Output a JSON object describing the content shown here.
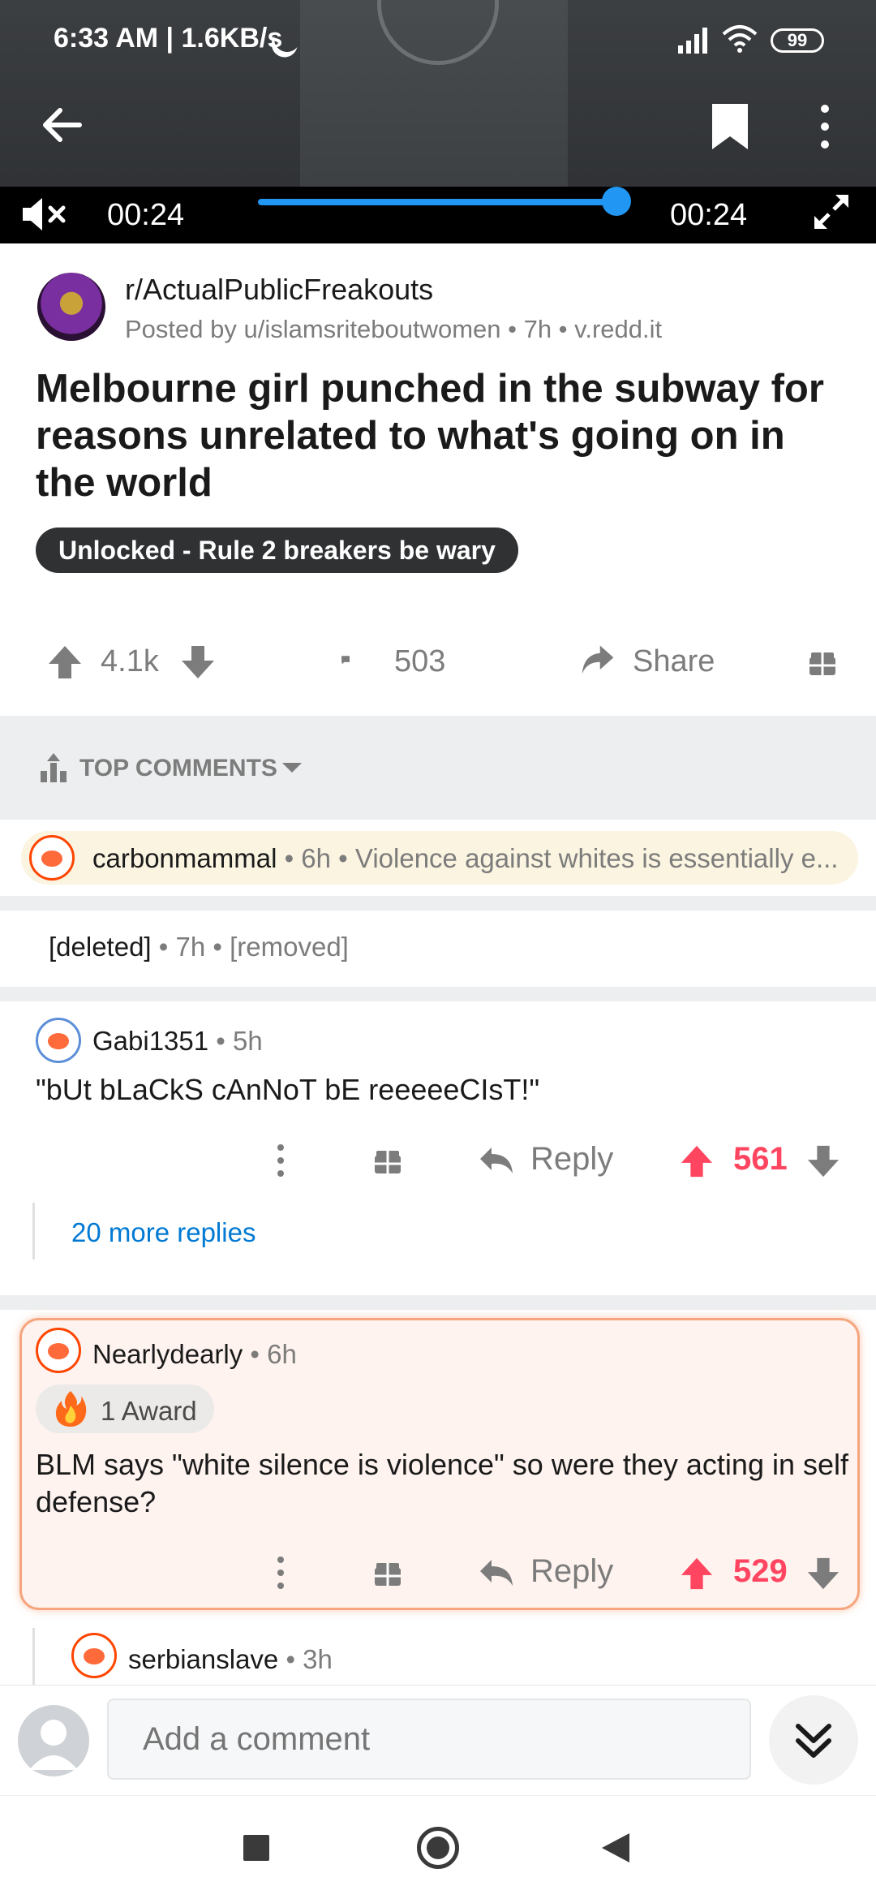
{
  "status_bar": {
    "time_speed": "6:33 AM | 1.6KB/s",
    "battery": "99"
  },
  "video": {
    "current_time": "00:24",
    "total_time": "00:24",
    "progress": 1.0,
    "accent_color": "#2196f3"
  },
  "post": {
    "subreddit": "r/ActualPublicFreakouts",
    "meta": "Posted by u/islamsriteboutwomen • 7h • v.redd.it",
    "title": "Melbourne girl punched in the subway for reasons unrelated to what's going on in the world",
    "flair": "Unlocked - Rule 2 breakers be wary",
    "score": "4.1k",
    "comments": "503",
    "share_label": "Share"
  },
  "sort": {
    "label": "TOP COMMENTS"
  },
  "collapsed_comment": {
    "author": "carbonmammal",
    "meta": " • 6h • ",
    "preview": "Violence against whites is essentially e..."
  },
  "deleted_comment": {
    "author": "[deleted]",
    "meta": " • 7h • ",
    "body": "[removed]"
  },
  "comments": [
    {
      "author": "Gabi1351",
      "age": " • 5h",
      "body": "\"bUt bLaCkS cAnNoT bE reeeeeCIsT!\"",
      "reply_label": "Reply",
      "votes": "561",
      "more_replies": "20 more replies"
    },
    {
      "author": "Nearlydearly",
      "age": " • 6h",
      "award": "1 Award",
      "body": "BLM says \"white silence is violence\" so were they acting in self defense?",
      "reply_label": "Reply",
      "votes": "529"
    },
    {
      "author": "serbianslave",
      "age": " • 3h"
    }
  ],
  "composer": {
    "placeholder": "Add a comment"
  },
  "colors": {
    "upvoted": "#ff4560",
    "link": "#0079d3",
    "highlight_border": "#f5a67e"
  }
}
